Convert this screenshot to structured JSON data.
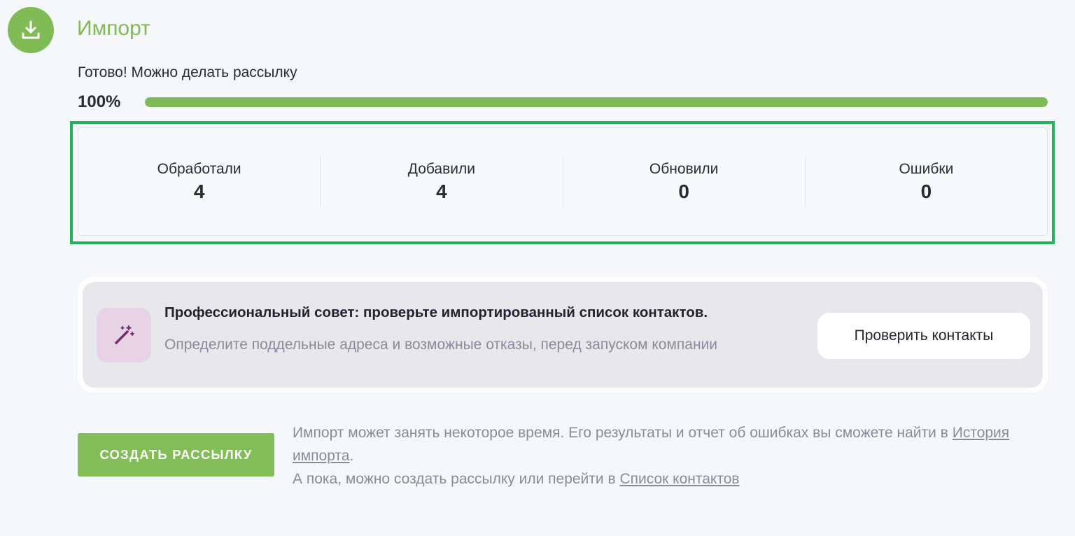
{
  "header": {
    "icon": "download-icon",
    "title": "Импорт"
  },
  "status": {
    "message": "Готово! Можно делать рассылку",
    "percent_label": "100%",
    "progress": 1.0
  },
  "stats": [
    {
      "label": "Обработали",
      "value": "4"
    },
    {
      "label": "Добавили",
      "value": "4"
    },
    {
      "label": "Обновили",
      "value": "0"
    },
    {
      "label": "Ошибки",
      "value": "0"
    }
  ],
  "tip": {
    "icon": "magic-wand-icon",
    "title": "Профессиональный совет: проверьте импортированный список контактов.",
    "description": "Определите поддельные адреса и возможные отказы, перед запуском компании",
    "button_label": "Проверить контакты"
  },
  "actions": {
    "create_label": "СОЗДАТЬ РАССЫЛКУ"
  },
  "info": {
    "line1": "Импорт может занять некоторое время. Его результаты и отчет об ошибках вы сможете найти в ",
    "history_link": "История импорта",
    "line1_end": ".",
    "line2": "А пока, можно создать рассылку или перейти в ",
    "contacts_link": "Список контактов"
  },
  "colors": {
    "accent_green": "#80bb55",
    "highlight_green": "#22b35a",
    "tip_icon_bg": "#e6d3e4",
    "tip_icon_fg": "#7a2a6e"
  }
}
